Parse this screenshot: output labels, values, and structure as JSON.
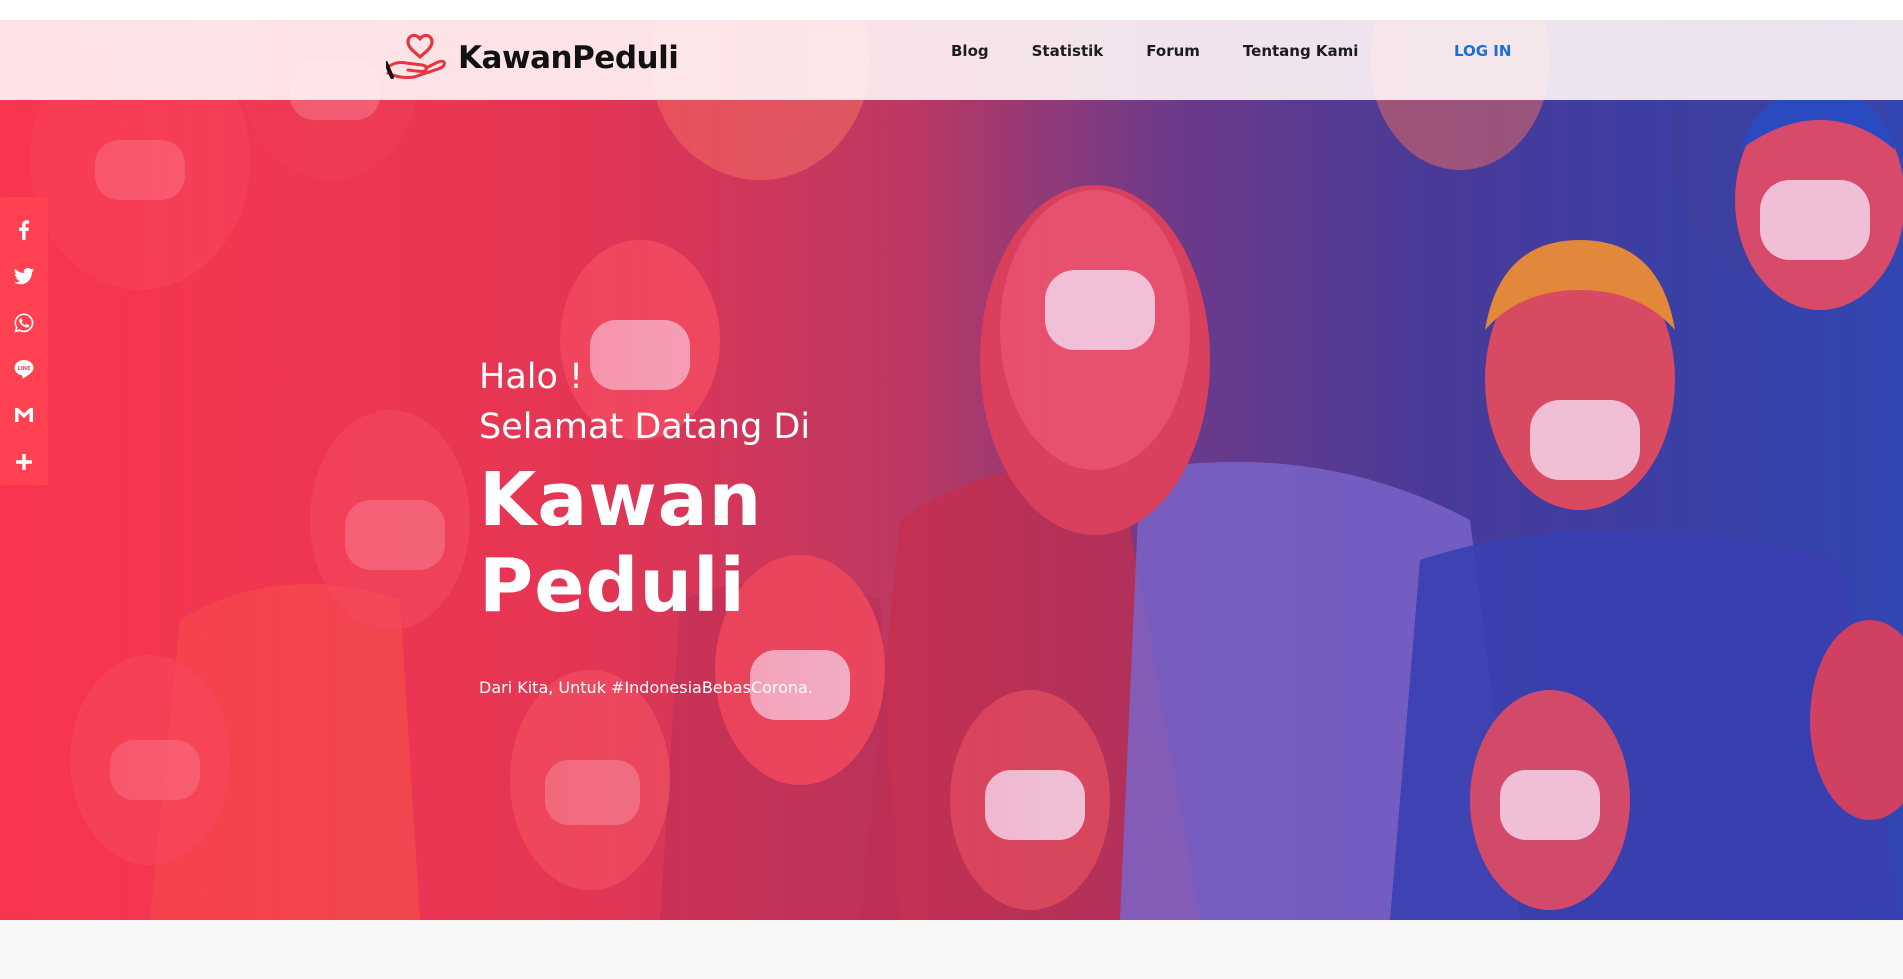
{
  "colors": {
    "accent": "#ff4152",
    "login": "#1a6fd6",
    "nav_text": "#1c1c1c",
    "hero_text": "#ffffff",
    "navbar_bg": "#fff6f7"
  },
  "navbar": {
    "logo_icon": "heart-hand-logo",
    "brand_name": "KawanPeduli",
    "links": [
      {
        "label": "Blog"
      },
      {
        "label": "Statistik"
      },
      {
        "label": "Forum"
      },
      {
        "label": "Tentang Kami"
      }
    ],
    "login_label": "LOG IN"
  },
  "share_bar": {
    "items": [
      {
        "icon": "facebook-icon"
      },
      {
        "icon": "twitter-icon"
      },
      {
        "icon": "whatsapp-icon"
      },
      {
        "icon": "line-icon"
      },
      {
        "icon": "gmail-icon"
      },
      {
        "icon": "plus-icon"
      }
    ]
  },
  "hero": {
    "greeting_line1": "Halo !",
    "greeting_line2": "Selamat Datang Di",
    "title_line1": "Kawan",
    "title_line2": "Peduli",
    "tagline": "Dari Kita, Untuk #IndonesiaBebasCorona."
  }
}
